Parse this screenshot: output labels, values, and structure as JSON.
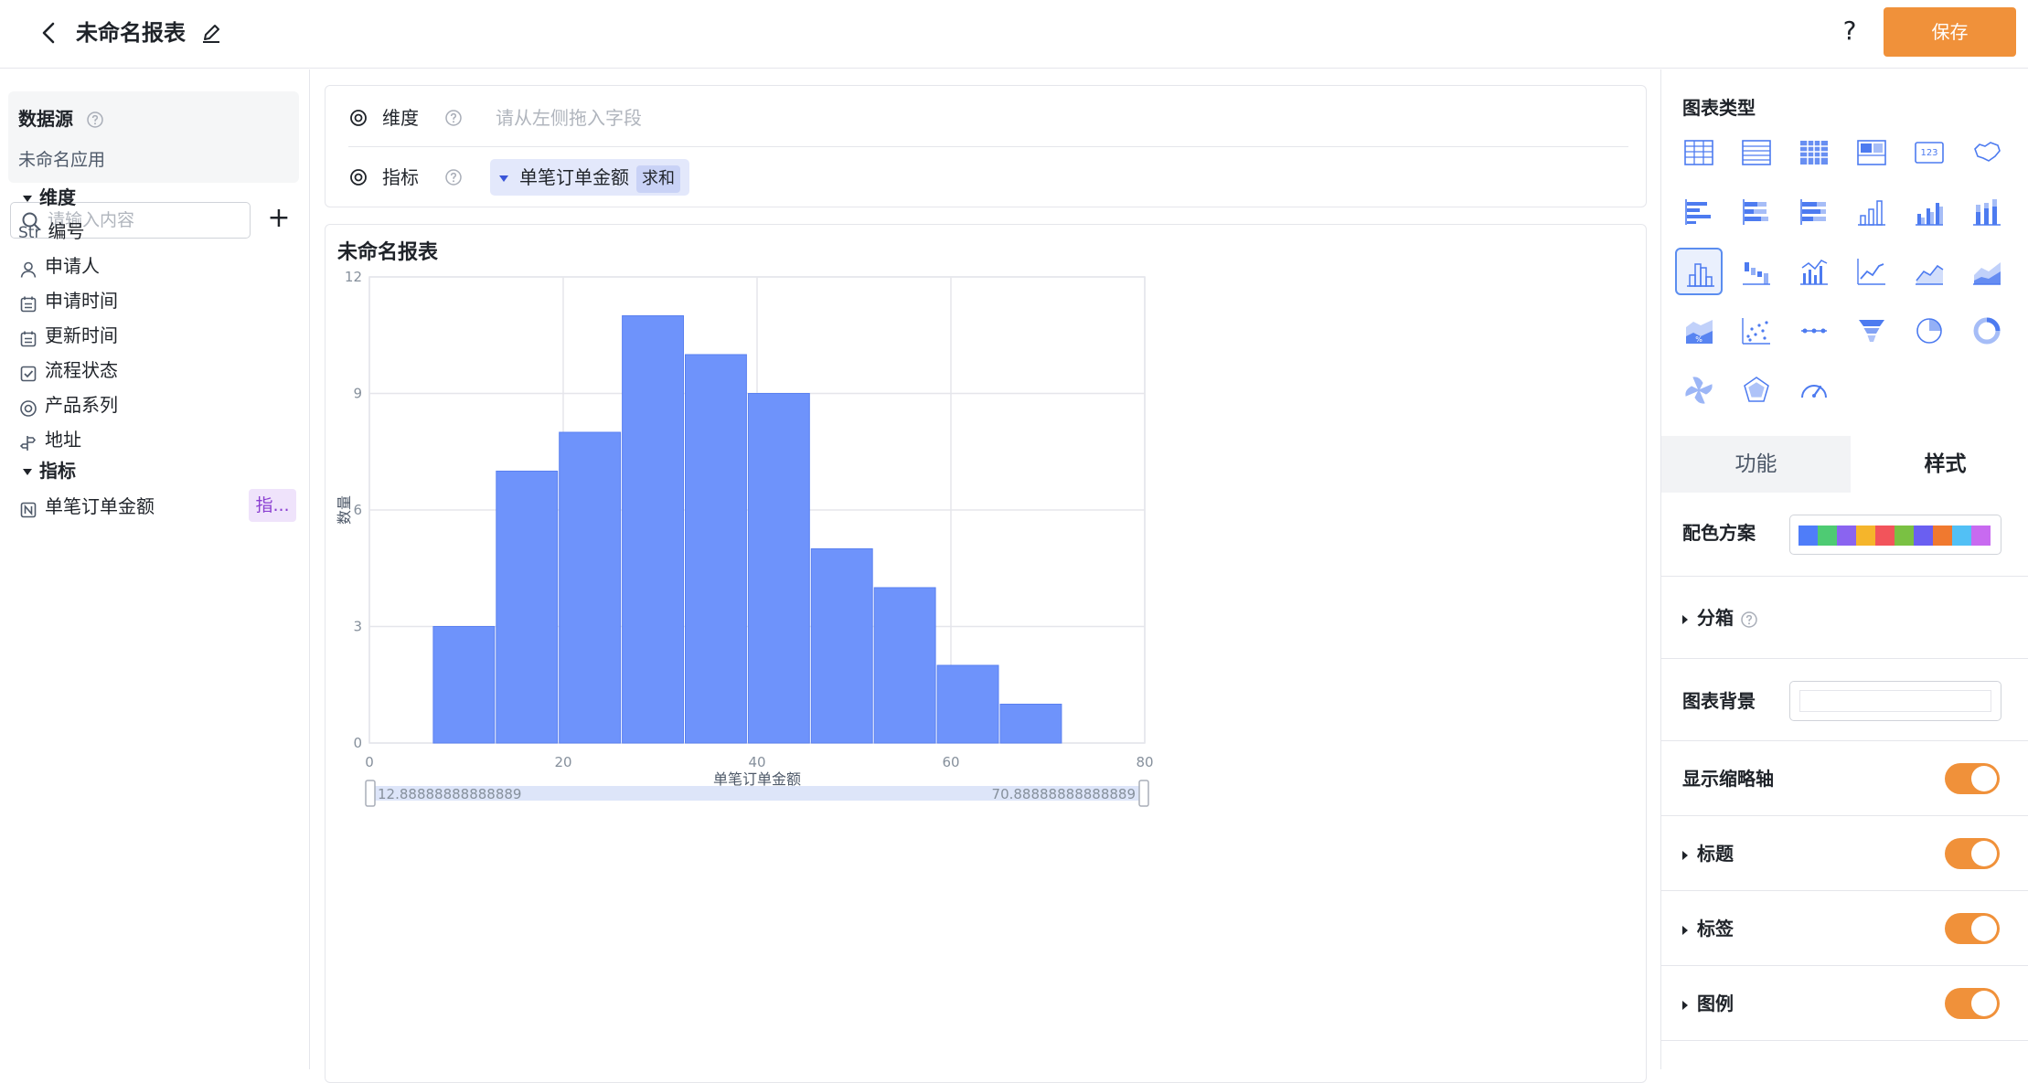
{
  "header": {
    "title": "未命名报表",
    "help_label": "?",
    "save_label": "保存"
  },
  "sidebar": {
    "datasource_title": "数据源",
    "datasource_app": "未命名应用",
    "search_placeholder": "请输入内容",
    "add_label": "+",
    "dimension_group": "维度",
    "dimensions": [
      {
        "label": "编号",
        "icon": "str-type-icon",
        "type_tag": "Str"
      },
      {
        "label": "申请人",
        "icon": "person-icon"
      },
      {
        "label": "申请时间",
        "icon": "calendar-icon"
      },
      {
        "label": "更新时间",
        "icon": "calendar-icon"
      },
      {
        "label": "流程状态",
        "icon": "checkbox-icon"
      },
      {
        "label": "产品系列",
        "icon": "radio-icon"
      },
      {
        "label": "地址",
        "icon": "location-icon"
      }
    ],
    "metric_group": "指标",
    "metrics": [
      {
        "label": "单笔订单金额",
        "icon": "number-icon",
        "tag": "指..."
      }
    ]
  },
  "config": {
    "dimension_label": "维度",
    "dimension_placeholder": "请从左侧拖入字段",
    "metric_label": "指标",
    "metric_field": "单笔订单金额",
    "metric_agg": "求和"
  },
  "chart": {
    "title": "未命名报表"
  },
  "chart_data": {
    "type": "bar",
    "subtype": "histogram",
    "bins": [
      [
        6.5,
        13
      ],
      [
        13,
        19.5
      ],
      [
        19.5,
        26
      ],
      [
        26,
        32.5
      ],
      [
        32.5,
        39
      ],
      [
        39,
        45.5
      ],
      [
        45.5,
        52
      ],
      [
        52,
        58.5
      ],
      [
        58.5,
        65
      ],
      [
        65,
        71.5
      ]
    ],
    "values": [
      3,
      7,
      8,
      11,
      10,
      9,
      5,
      4,
      2,
      1
    ],
    "xlim": [
      0,
      80
    ],
    "ylim": [
      0,
      12
    ],
    "xticks": [
      0,
      20,
      40,
      60,
      80
    ],
    "yticks": [
      0,
      3,
      6,
      9,
      12
    ],
    "xlabel": "单笔订单金额",
    "ylabel": "数量",
    "grid": true,
    "bar_color": "#6e93fb",
    "zoom_start_label": "12.88888888888889",
    "zoom_end_label": "70.88888888888889"
  },
  "right_panel": {
    "chart_type_title": "图表类型",
    "chart_types": [
      "table-icon",
      "detail-table-icon",
      "pivot-table-icon",
      "cross-table-icon",
      "indicator-card-icon",
      "map-icon",
      "bar-horizontal-icon",
      "stacked-bar-horizontal-icon",
      "percent-bar-horizontal-icon",
      "column-icon",
      "grouped-column-icon",
      "stacked-column-icon",
      "histogram-icon",
      "waterfall-icon",
      "column-line-icon",
      "line-icon",
      "area-icon",
      "stacked-area-icon",
      "percent-area-icon",
      "scatter-icon",
      "dot-line-icon",
      "funnel-icon",
      "pie-icon",
      "donut-icon",
      "windmill-icon",
      "radar-icon",
      "gauge-icon"
    ],
    "selected_type": "histogram-icon",
    "tab_function": "功能",
    "tab_style": "样式",
    "palette_label": "配色方案",
    "palette_colors": [
      "#4f7df9",
      "#4ecb73",
      "#8a64f0",
      "#f5b52b",
      "#f2545b",
      "#7ac143",
      "#6a5ff1",
      "#f0792f",
      "#52c0f5",
      "#c86af0"
    ],
    "binning_label": "分箱",
    "background_label": "图表背景",
    "show_zoom_label": "显示缩略轴",
    "title_label": "标题",
    "label_label": "标签",
    "legend_label": "图例",
    "accent_color": "#f0913a"
  }
}
